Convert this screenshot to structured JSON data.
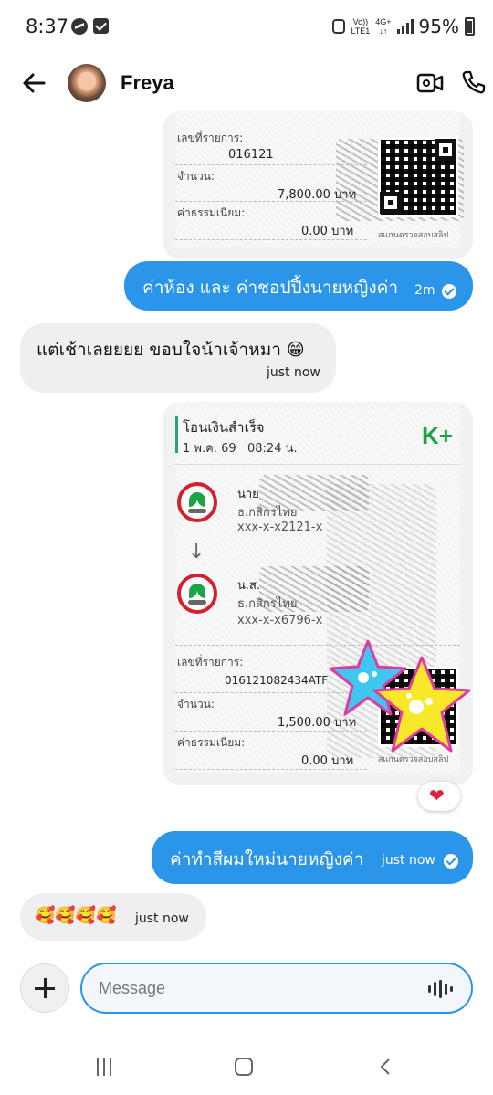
{
  "status_bar": {
    "time": "8:37",
    "net_top": "Vo))",
    "net_bottom": "LTE1",
    "net2_top": "4G+",
    "net2_bottom": "↓↑",
    "battery": "95%"
  },
  "header": {
    "contact_name": "Freya"
  },
  "slip_top": {
    "ref_label": "เลขที่รายการ:",
    "ref_value": "016121",
    "amount_label": "จำนวน:",
    "amount_value": "7,800.00 บาท",
    "fee_label": "ค่าธรรมเนียม:",
    "fee_value": "0.00 บาท",
    "qr_caption": "สแกนตรวจสอบสลิป"
  },
  "messages": {
    "m1": {
      "text": "ค่าห้อง และ ค่าชอปปิ้งนายหญิงค่า",
      "time": "2m"
    },
    "m2": {
      "text": "แต่เช้าเลยยยย ขอบใจน้าเจ้าหมา 😁",
      "time": "just now"
    },
    "m3": {
      "text": "ค่าทำสีผมใหม่นายหญิงค่า",
      "time": "just now"
    },
    "m4": {
      "text": "🥰🥰🥰🥰",
      "time": "just now"
    }
  },
  "slip_main": {
    "title": "โอนเงินสำเร็จ",
    "datetime": "1 พ.ค. 69   08:24 น.",
    "brand": "K+",
    "from_prefix": "นาย",
    "from_bank": "ธ.กสิกรไทย",
    "from_account": "xxx-x-x2121-x",
    "arrow": "↓",
    "to_prefix": "น.ส.",
    "to_bank": "ธ.กสิกรไทย",
    "to_account": "xxx-x-x6796-x",
    "ref_label": "เลขที่รายการ:",
    "ref_value": "016121082434ATF",
    "amount_label": "จำนวน:",
    "amount_value": "1,500.00 บาท",
    "fee_label": "ค่าธรรมเนียม:",
    "fee_value": "0.00 บาท",
    "qr_caption": "สแกนตรวจสอบสลิป"
  },
  "reaction": {
    "icon": "heart-icon",
    "glyph": "❤"
  },
  "composer": {
    "placeholder": "Message"
  },
  "colors": {
    "outgoing_bubble": "#2b95e9",
    "incoming_bubble": "#efeff1",
    "accent": "#2b95e9",
    "kbank_green": "#1ba345"
  }
}
